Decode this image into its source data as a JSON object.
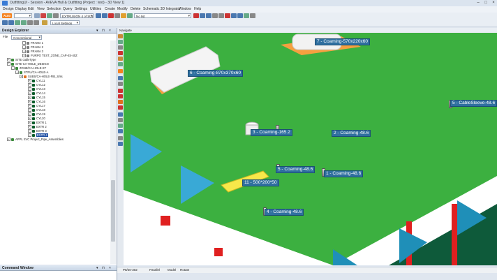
{
  "window": {
    "title": "OutfittingUI - Session - AVEVA Hull & Outfitting (Project : test) - 3D View 1]"
  },
  "menu": [
    "Design",
    "Display",
    "Edit",
    "View",
    "Selection",
    "Query",
    "Settings",
    "Utilities",
    "Create",
    "Modify",
    "Delete",
    "Schematic 3D Integrator",
    "Window",
    "Help"
  ],
  "toolbar": {
    "auto": "Auto",
    "element_combo": "EXTRUSION 4 of SUBSTRUC",
    "noitem_combo": "No list",
    "level_combo": "Local Settings"
  },
  "explorer": {
    "title": "Design Explorer",
    "file_label": "File",
    "file_value": "Conventional",
    "rows": [
      {
        "text": "FRAMA 1",
        "indent": 32,
        "color": "#7a7a7a"
      },
      {
        "text": "FRAMA 2",
        "indent": 32,
        "color": "#7a7a7a"
      },
      {
        "text": "FRAMA 3",
        "indent": 32,
        "color": "#7a7a7a"
      },
      {
        "text": "PURPO TEST_ZONE_CAP-4S-40Z",
        "indent": 32,
        "color": "#7a7a7a"
      },
      {
        "text": "SITE cableType",
        "indent": 10,
        "color": "#3a8a3a"
      },
      {
        "text": "SITE-CA-HOLE_DESIGN",
        "indent": 10,
        "color": "#3a8a3a"
      },
      {
        "text": "ZONE/CA-HOLE-ST",
        "indent": 16,
        "color": "#3a8a3a"
      },
      {
        "text": "STRU/CA-HOLE-A",
        "indent": 22,
        "color": "#3a8a3a"
      },
      {
        "text": "SUBS/CA-HOLE-FIB_S/ss",
        "indent": 28,
        "color": "#e07020"
      },
      {
        "text": "CYL11",
        "indent": 40,
        "color": "#0a5c2a"
      },
      {
        "text": "CYL12",
        "indent": 40,
        "color": "#0a5c2a"
      },
      {
        "text": "CYL13",
        "indent": 40,
        "color": "#0a5c2a"
      },
      {
        "text": "CYL14",
        "indent": 40,
        "color": "#0a5c2a"
      },
      {
        "text": "CYL15",
        "indent": 40,
        "color": "#0a5c2a"
      },
      {
        "text": "CYL16",
        "indent": 40,
        "color": "#0a5c2a"
      },
      {
        "text": "CYL17",
        "indent": 40,
        "color": "#0a5c2a"
      },
      {
        "text": "CYL18",
        "indent": 40,
        "color": "#0a5c2a"
      },
      {
        "text": "CYL19",
        "indent": 40,
        "color": "#0a5c2a"
      },
      {
        "text": "CYL20",
        "indent": 40,
        "color": "#0a5c2a"
      },
      {
        "text": "EXTR 1",
        "indent": 40,
        "color": "#0a5c2a"
      },
      {
        "text": "EXTR 2",
        "indent": 40,
        "color": "#0a5c2a"
      },
      {
        "text": "EXTR 3",
        "indent": 40,
        "color": "#0a5c2a"
      },
      {
        "text": "EXTR 4",
        "indent": 40,
        "color": "#0a5c2a",
        "selected": true
      },
      {
        "text": "APPL SVC Project_Pipe_Assemblies",
        "indent": 10,
        "color": "#3a8a3a"
      }
    ]
  },
  "command_window": {
    "title": "Command Window"
  },
  "viewport": {
    "tab": "Navigate"
  },
  "labels": [
    "7 - Coaming-570x220x60",
    "6 - Coaming-870x370x60",
    "5 - CableSleeve-48.6",
    "3 - Coaming-165.2",
    "2 - Coaming-48.6",
    "5 - Coaming-48.6",
    "1 - Coaming-48.6",
    "11 - 500*200*50",
    "4 - Coaming-48.6"
  ],
  "status": {
    "coords": "P8/20-302",
    "mode": "Parallel",
    "model": "Model",
    "rotate": "Rotate"
  },
  "colors": {
    "deck": "#3cb040",
    "accent": "#f58220",
    "label": "#2f6f9f"
  }
}
